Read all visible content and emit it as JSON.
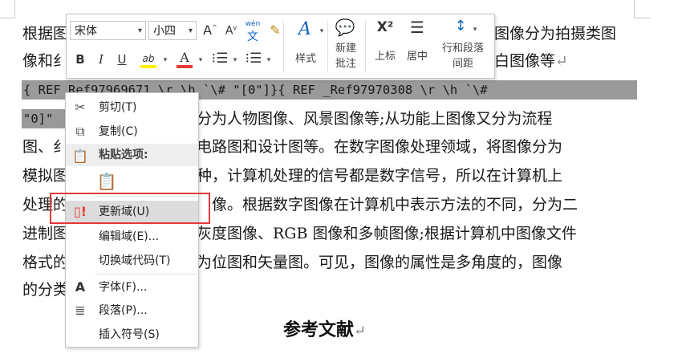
{
  "document": {
    "lines": [
      "根据图像的内容可以将数字图像分为拍摄类图像和非拍摄类图像等，根据图像的色彩可以将数字图像分为拍摄类图",
      "像和纹理图像；根据图像的颜色可以分为彩色图像和黑白图像等",
      "",
      "",
      "图、纹理图像、人物图像、风景图像等;从功能上图像又分为流程图、组织结构图、电路图和设计图等。在数字图像处理领域，将图像分为",
      "模拟图像和数字图像两种，计算机处理的信号都是数字信号，所以在计算机上",
      "处理的图像均为数字图像。根据数字图像在计算机中表示方法的不同，分为二",
      "进制图像、灰度图像、RGB 图像和多帧图像;根据计算机中图像文件",
      "格式的不同，可分为位图和矢量图。可见，图像的属性是多角度的，图像",
      "的分类也是多样的。"
    ],
    "visible_segments": {
      "line1_left": "根据图",
      "line1_right": "图像分为拍摄类图",
      "line2_left": "像和纟",
      "line2_right": "白图像等",
      "line4_right": "分为人物图像、风景图像等;从功能上图像又分为流程",
      "line5_left": "图、纟",
      "line5_right": "电路图和设计图等。在数字图像处理领域，将图像分为",
      "line6_left": "模拟图",
      "line6_right": "种，计算机处理的信号都是数字信号，所以在计算机上",
      "line7_left": "处理的",
      "line7_right": "像。根据数字图像在计算机中表示方法的不同，分为二",
      "line8_left": "进制图",
      "line8_right": "灰度图像、RGB 图像和多帧图像;根据计算机中图像文件",
      "line9_left": "格式的",
      "line9_right": "为位图和矢量图。可见，图像的属性是多角度的，图像",
      "line10_left": "的分类"
    },
    "field_code_line1": "{ REF  Ref97969671 \\r \\h `\\#  \"[0\"]}{ REF  _Ref97970308 \\r \\h `\\#",
    "field_code_line2": "\"0]\"",
    "heading": "参考文献",
    "paragraph_mark": "↵"
  },
  "mini_toolbar": {
    "font_name": "宋体",
    "font_size": "小四",
    "buttons": {
      "grow_font": "A",
      "shrink_font": "A",
      "phonetic": "文",
      "format_painter": "🖌",
      "bold": "B",
      "italic": "I",
      "underline": "U",
      "highlight": "ab",
      "font_color": "A",
      "bullets": "☰",
      "numbering": "☰",
      "styles": "A",
      "new_comment": "＋",
      "superscript": "X²",
      "center": "☰",
      "line_spacing": "↕"
    },
    "labels": {
      "styles": "样式",
      "new_comment_line1": "新建",
      "new_comment_line2": "批注",
      "superscript": "上标",
      "center": "居中",
      "line_spacing_line1": "行和段落",
      "line_spacing_line2": "间距"
    }
  },
  "context_menu": {
    "items": [
      {
        "label": "剪切(T)",
        "icon": "scissors-icon"
      },
      {
        "label": "复制(C)",
        "icon": "copy-icon"
      },
      {
        "label": "粘贴选项:",
        "icon": "paste-icon"
      },
      {
        "label": "更新域(U)",
        "icon": "update-field-icon"
      },
      {
        "label": "编辑域(E)...",
        "icon": ""
      },
      {
        "label": "切换域代码(T)",
        "icon": ""
      },
      {
        "label": "字体(F)...",
        "icon": "font-icon"
      },
      {
        "label": "段落(P)...",
        "icon": "paragraph-icon"
      },
      {
        "label": "插入符号(S)",
        "icon": ""
      }
    ],
    "highlighted_item": "更新域(U)",
    "highlight_color": "#e53935"
  }
}
